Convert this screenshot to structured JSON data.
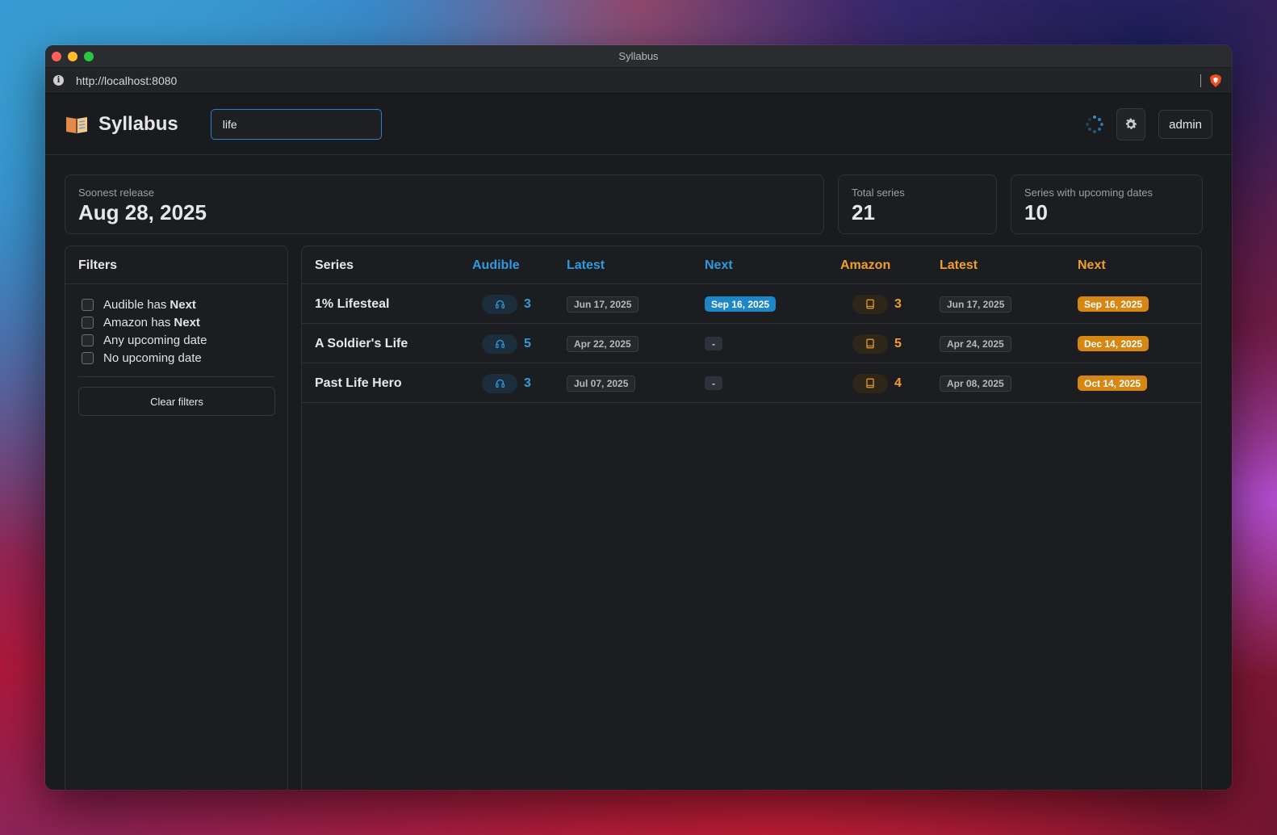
{
  "window": {
    "title": "Syllabus"
  },
  "browser": {
    "url": "http://localhost:8080"
  },
  "header": {
    "brand": "Syllabus",
    "search_value": "life",
    "admin_label": "admin"
  },
  "stats": {
    "soonest_label": "Soonest release",
    "soonest_value": "Aug 28, 2025",
    "total_label": "Total series",
    "total_value": "21",
    "upcoming_label": "Series with upcoming dates",
    "upcoming_value": "10"
  },
  "filters": {
    "title": "Filters",
    "items": [
      {
        "prefix": "Audible has",
        "bold": "Next",
        "checked": false
      },
      {
        "prefix": "Amazon has",
        "bold": "Next",
        "checked": false
      },
      {
        "prefix": "Any upcoming date",
        "bold": "",
        "checked": false
      },
      {
        "prefix": "No upcoming date",
        "bold": "",
        "checked": false
      }
    ],
    "clear_label": "Clear filters"
  },
  "table": {
    "headers": {
      "series": "Series",
      "audible": "Audible",
      "audible_latest": "Latest",
      "audible_next": "Next",
      "amazon": "Amazon",
      "amazon_latest": "Latest",
      "amazon_next": "Next"
    },
    "rows": [
      {
        "series": "1% Lifesteal",
        "audible_count": "3",
        "audible_latest": "Jun 17, 2025",
        "audible_next": "Sep 16, 2025",
        "amazon_count": "3",
        "amazon_latest": "Jun 17, 2025",
        "amazon_next": "Sep 16, 2025"
      },
      {
        "series": "A Soldier's Life",
        "audible_count": "5",
        "audible_latest": "Apr 22, 2025",
        "audible_next": "-",
        "amazon_count": "5",
        "amazon_latest": "Apr 24, 2025",
        "amazon_next": "Dec 14, 2025"
      },
      {
        "series": "Past Life Hero",
        "audible_count": "3",
        "audible_latest": "Jul 07, 2025",
        "audible_next": "-",
        "amazon_count": "4",
        "amazon_latest": "Apr 08, 2025",
        "amazon_next": "Oct 14, 2025"
      }
    ]
  },
  "colors": {
    "audible_accent": "#2f9bde",
    "amazon_accent": "#f0a02a",
    "search_focus": "#2f7fcf"
  },
  "icons": {
    "logo": "open-book-icon",
    "settings": "gear-icon",
    "loading": "spinner-icon",
    "audible_chip": "headphones-icon",
    "amazon_chip": "book-icon"
  }
}
